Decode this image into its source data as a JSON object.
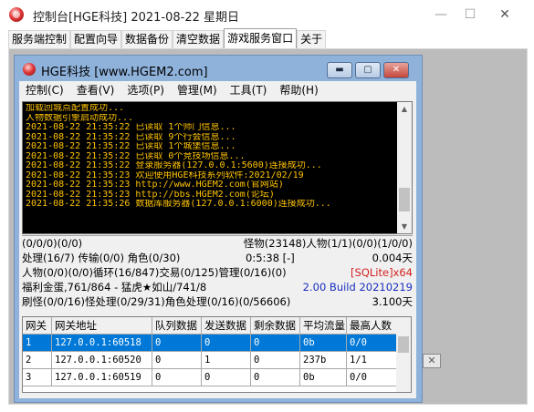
{
  "outer_window": {
    "title": "控制台[HGE科技] 2021-08-22 星期日",
    "min": "—",
    "max": "☐",
    "close": "✕"
  },
  "tabs": [
    {
      "label": "服务端控制"
    },
    {
      "label": "配置向导"
    },
    {
      "label": "数据备份"
    },
    {
      "label": "清空数据"
    },
    {
      "label": "游戏服务窗口"
    },
    {
      "label": "关于"
    }
  ],
  "inner_window": {
    "title": "HGE科技 [www.HGEM2.com]",
    "min": "▬",
    "max": "▢",
    "close": "✕"
  },
  "menu": [
    {
      "label": "控制(C)"
    },
    {
      "label": "查看(V)"
    },
    {
      "label": "选项(P)"
    },
    {
      "label": "管理(M)"
    },
    {
      "label": "工具(T)"
    },
    {
      "label": "帮助(H)"
    }
  ],
  "log": [
    "加载回城点配置成功...",
    "人物数据引擎启动成功...",
    "2021-08-22 21:35:22 已读取 1个师门信息...",
    "2021-08-22 21:35:22 已读取 9个行会信息...",
    "2021-08-22 21:35:22 已读取 1个城堡信息...",
    "2021-08-22 21:35:22 已读取 0个竞技场信息...",
    "2021-08-22 21:35:22 登录服务器(127.0.0.1:5600)连接成功...",
    "2021-08-22 21:35:23 欢迎使用HGE科技系列软件:2021/02/19",
    "2021-08-22 21:35:23 http://www.HGEM2.com(官网站)",
    "2021-08-22 21:35:23 http://bbs.HGEM2.com(论坛)",
    "2021-08-22 21:35:26 数据库服务器(127.0.0.1:6000)连接成功..."
  ],
  "status": {
    "line1_left": "(0/0/0)(0/0)",
    "line1_right": "怪物(23148)人物(1/1)(0/0)(1/0/0)",
    "line2_left": "处理(16/7) 传输(0/0) 角色(0/30)",
    "line2_mid": "0:5:38 [-]",
    "line2_right": "0.004天",
    "line3_left": "人物(0/0)(0/0)循环(16/847)交易(0/125)管理(0/16)(0)",
    "line3_right": "[SQLite]x64",
    "line4_left": "福利金蛋,761/864 - 猛虎★如山/741/8",
    "line4_right": "2.00 Build 20210219",
    "line5_left": "刷怪(0/0/16)怪处理(0/29/31)角色处理(0/16)(0/56606)",
    "line5_right": "3.100天"
  },
  "table": {
    "headers": [
      "网关",
      "网关地址",
      "队列数据",
      "发送数据",
      "剩余数据",
      "平均流量",
      "最高人数"
    ],
    "rows": [
      [
        "1",
        "127.0.0.1:60518",
        "0",
        "0",
        "0",
        "0b",
        "0/0"
      ],
      [
        "2",
        "127.0.0.1:60520",
        "0",
        "1",
        "0",
        "237b",
        "1/1"
      ],
      [
        "3",
        "127.0.0.1:60519",
        "0",
        "0",
        "0",
        "0b",
        "0/0"
      ]
    ]
  },
  "outer_close_glyph": "✕",
  "colors": {
    "log_text": "#ffc400",
    "log_bg": "#000000",
    "selection": "#0078d7",
    "sqlite": "#d42020",
    "build": "#1a2fbf"
  }
}
